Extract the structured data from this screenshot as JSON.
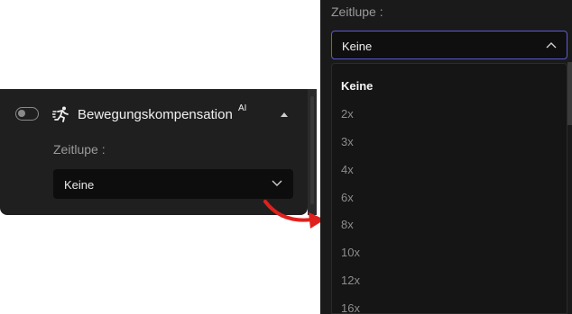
{
  "left": {
    "feature_title": "Bewegungskompensation",
    "ai_badge": "AI",
    "label": "Zeitlupe :",
    "select_value": "Keine"
  },
  "right": {
    "label": "Zeitlupe :",
    "select_value": "Keine",
    "options": [
      "Keine",
      "2x",
      "3x",
      "4x",
      "6x",
      "8x",
      "10x",
      "12x",
      "16x"
    ],
    "selected_index": 0
  },
  "colors": {
    "accent_border": "#5b5bd6",
    "arrow": "#e0201c"
  },
  "icons": {
    "feature": "running-person-icon",
    "collapse": "triangle-up-icon",
    "left_chevron": "chevron-down-icon",
    "right_chevron": "chevron-up-icon",
    "arrow": "curved-arrow-icon"
  }
}
